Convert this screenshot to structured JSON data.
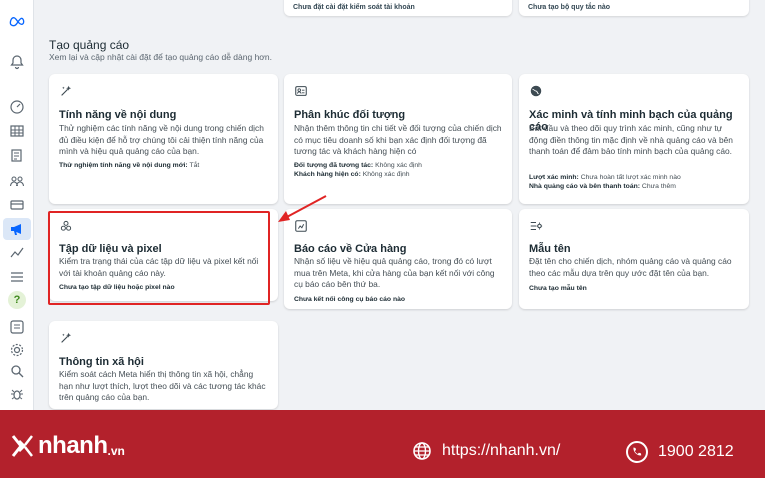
{
  "top_cards": [
    {
      "text": "Chưa đặt cài đặt kiểm soát tài khoản"
    },
    {
      "text": "Chưa tạo bộ quy tắc nào"
    }
  ],
  "section": {
    "title": "Tạo quảng cáo",
    "subtitle": "Xem lại và cập nhật cài đặt để tạo quảng cáo dễ dàng hơn."
  },
  "cards": [
    {
      "title": "Tính năng về nội dung",
      "icon": "sparkle-icon",
      "description": "Thử nghiệm các tính năng về nội dung trong chiến dịch đủ điều kiện để hỗ trợ chúng tôi cải thiện tính năng của mình và hiệu quả quảng cáo của bạn.",
      "meta": [
        {
          "label": "Thử nghiệm tính năng về nội dung mới:",
          "value": "Tắt"
        }
      ]
    },
    {
      "title": "Phân khúc đối tượng",
      "icon": "audience-icon",
      "description": "Nhận thêm thông tin chi tiết về đối tượng của chiến dịch có mục tiêu doanh số khi bạn xác định đối tượng đã tương tác và khách hàng hiện có",
      "meta": [
        {
          "label": "Đối tượng đã tương tác:",
          "value": "Không xác định"
        },
        {
          "label": "Khách hàng hiện có:",
          "value": "Không xác định"
        }
      ]
    },
    {
      "title": "Xác minh và tính minh bạch của quảng cáo",
      "icon": "globe-icon",
      "description": "Bắt đầu và theo dõi quy trình xác minh, cũng như tự động điền thông tin mặc định về nhà quảng cáo và bên thanh toán để đảm bảo tính minh bạch của quảng cáo.",
      "meta": [
        {
          "label": "Lượt xác minh:",
          "value": "Chưa hoàn tất lượt xác minh nào"
        },
        {
          "label": "Nhà quảng cáo và bên thanh toán:",
          "value": "Chưa thêm"
        }
      ]
    },
    {
      "title": "Tập dữ liệu và pixel",
      "icon": "dataset-icon",
      "description": "Kiểm tra trạng thái của các tập dữ liệu và pixel kết nối với tài khoản quảng cáo này.",
      "link": "Chưa tạo tập dữ liệu hoặc pixel nào"
    },
    {
      "title": "Báo cáo về Cửa hàng",
      "icon": "shop-report-icon",
      "description": "Nhận số liệu về hiệu quả quảng cáo, trong đó có lượt mua trên Meta, khi cửa hàng của bạn kết nối với công cụ báo cáo bên thứ ba.",
      "link": "Chưa kết nối công cụ báo cáo nào"
    },
    {
      "title": "Mẫu tên",
      "icon": "name-template-icon",
      "description": "Đặt tên cho chiến dịch, nhóm quảng cáo và quảng cáo theo các mẫu dựa trên quy ước đặt tên của bạn.",
      "link": "Chưa tạo mẫu tên"
    },
    {
      "title": "Thông tin xã hội",
      "icon": "sparkle-icon",
      "description": "Kiểm soát cách Meta hiển thị thông tin xã hội, chẳng hạn như lượt thích, lượt theo dõi và các tương tác khác trên quảng cáo của bạn."
    }
  ],
  "footer": {
    "brand": "nhanh",
    "brand_domain": ".vn",
    "website": "https://nhanh.vn/",
    "phone": "1900 2812",
    "bg_color": "#b3212c"
  }
}
